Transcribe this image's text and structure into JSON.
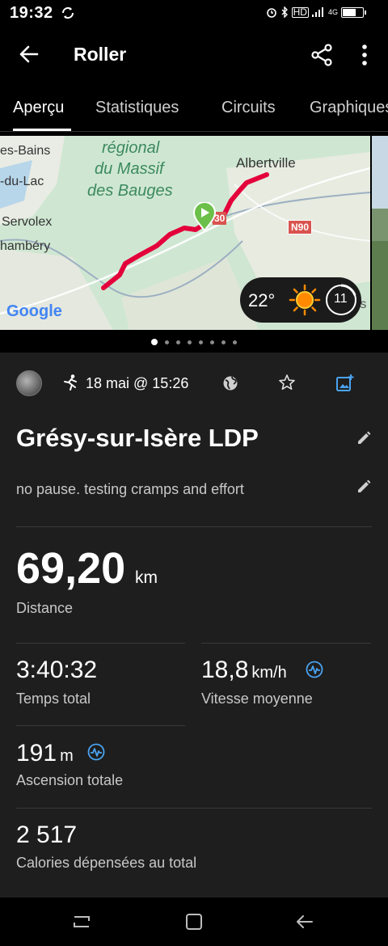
{
  "status": {
    "time": "19:32",
    "hd": "HD",
    "network": "4G"
  },
  "app_bar": {
    "title": "Roller"
  },
  "tabs": [
    "Aperçu",
    "Statistiques",
    "Circuits",
    "Graphiques"
  ],
  "map": {
    "labels": {
      "region1": "régional",
      "region2": "du Massif",
      "region3": "des Bauges",
      "albertville": "Albertville",
      "aix": "es-Bains",
      "lac": "-du-Lac",
      "servolex": "Servolex",
      "chambery": "hambéry",
      "road_n90": "N90",
      "road_30": "30",
      "google": "Google",
      "edge": "rs"
    },
    "weather": {
      "temperature": "22°",
      "uv": "11"
    },
    "route_color": "#e4003b"
  },
  "pager": {
    "count": 8,
    "active": 0
  },
  "activity": {
    "date": "18 mai @ 15:26",
    "title": "Grésy-sur-Isère LDP",
    "description": "no pause. testing cramps and effort"
  },
  "stats": {
    "distance": {
      "value": "69,20",
      "unit": "km",
      "label": "Distance"
    },
    "total_time": {
      "value": "3:40:32",
      "label": "Temps total"
    },
    "avg_speed": {
      "value": "18,8",
      "unit": "km/h",
      "label": "Vitesse moyenne"
    },
    "ascent": {
      "value": "191",
      "unit": "m",
      "label": "Ascension totale"
    },
    "calories": {
      "value": "2 517",
      "label": "Calories dépensées au total"
    }
  },
  "colors": {
    "accent_blue": "#4aa3f0",
    "marker_green": "#6cc04a"
  }
}
